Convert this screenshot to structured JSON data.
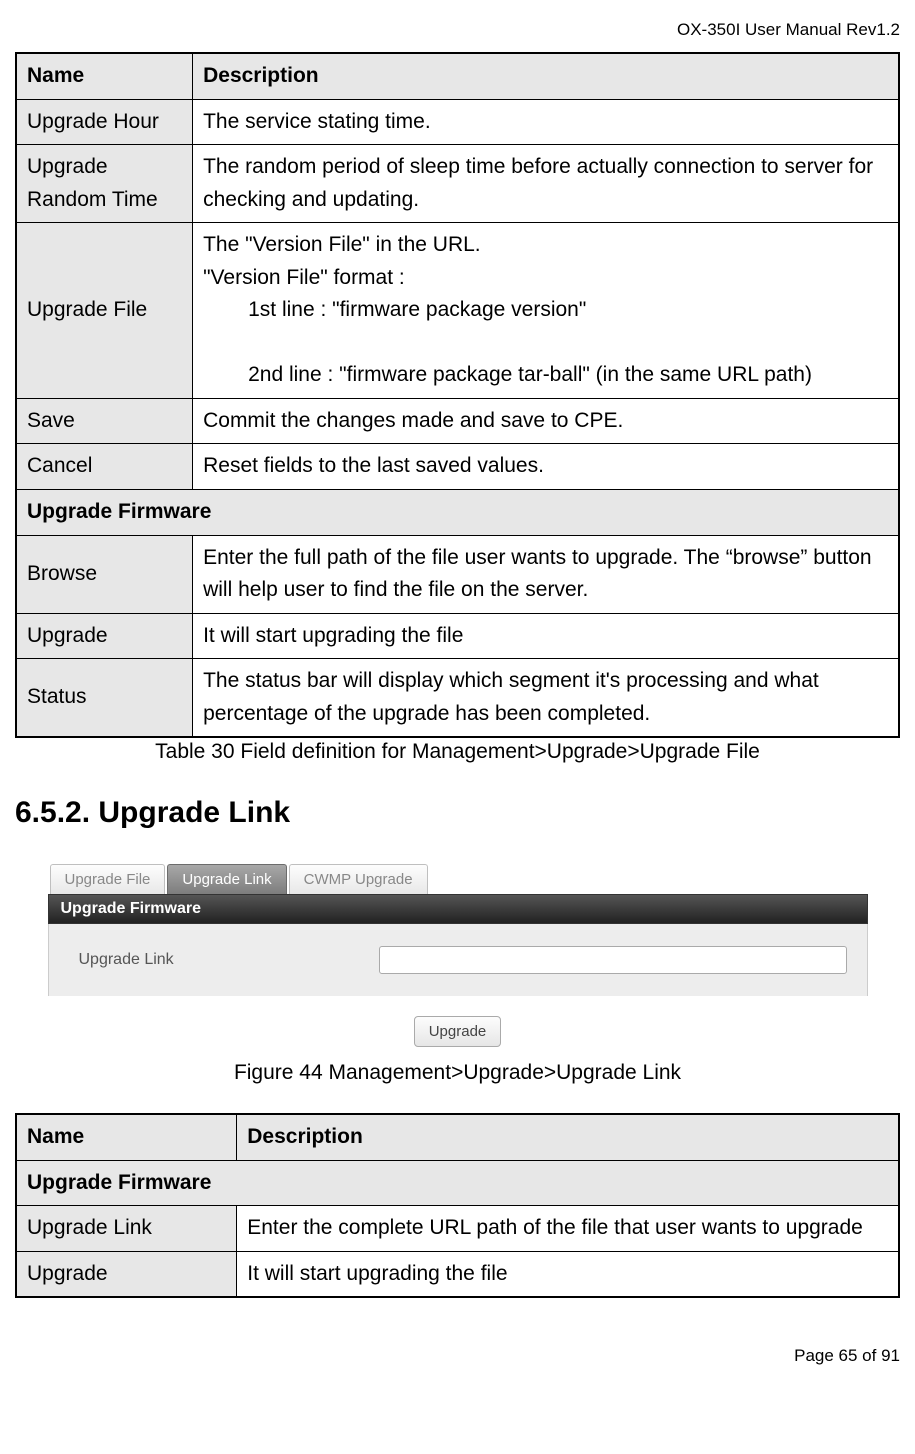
{
  "header": "OX-350I User Manual Rev1.2",
  "table1": {
    "col_name": "Name",
    "col_desc": "Description",
    "rows": [
      {
        "name": "Upgrade Hour",
        "desc": "The service stating time."
      },
      {
        "name": "Upgrade Random Time",
        "desc": "The random period of sleep time before actually connection to server for checking and updating."
      },
      {
        "name": "Upgrade File",
        "desc_lines": {
          "l1": "The \"Version File\" in the URL.",
          "l2": "\"Version File\" format :",
          "l3": "1st line : \"firmware package version\"",
          "l4": "2nd line : \"firmware package tar-ball\" (in the same URL path)"
        }
      },
      {
        "name": "Save",
        "desc": "Commit the changes made and save to CPE."
      },
      {
        "name": "Cancel",
        "desc": "Reset fields to the last saved values."
      }
    ],
    "section": "Upgrade Firmware",
    "rows2": [
      {
        "name": "Browse",
        "desc": "Enter the full path of the file user wants to upgrade. The “browse” button will help user to find the file on the server."
      },
      {
        "name": "Upgrade",
        "desc": "It will start upgrading the file"
      },
      {
        "name": "Status",
        "desc": "The status bar will display which segment it's processing and what percentage of the upgrade has been completed."
      }
    ],
    "caption": "Table 30 Field definition for Management>Upgrade>Upgrade File"
  },
  "heading": "6.5.2. Upgrade Link",
  "screenshot": {
    "tabs": {
      "t1": "Upgrade File",
      "t2": "Upgrade Link",
      "t3": "CWMP Upgrade"
    },
    "section_bar": "Upgrade Firmware",
    "field_label": "Upgrade Link",
    "input_value": "",
    "button": "Upgrade"
  },
  "figure_caption": "Figure 44      Management>Upgrade>Upgrade Link",
  "table2": {
    "col_name": "Name",
    "col_desc": "Description",
    "section": "Upgrade Firmware",
    "rows": [
      {
        "name": "Upgrade Link",
        "desc": "Enter the complete URL path of the file that user wants to upgrade"
      },
      {
        "name": "Upgrade",
        "desc": "It will start upgrading the file"
      }
    ]
  },
  "footer": "Page 65 of 91"
}
